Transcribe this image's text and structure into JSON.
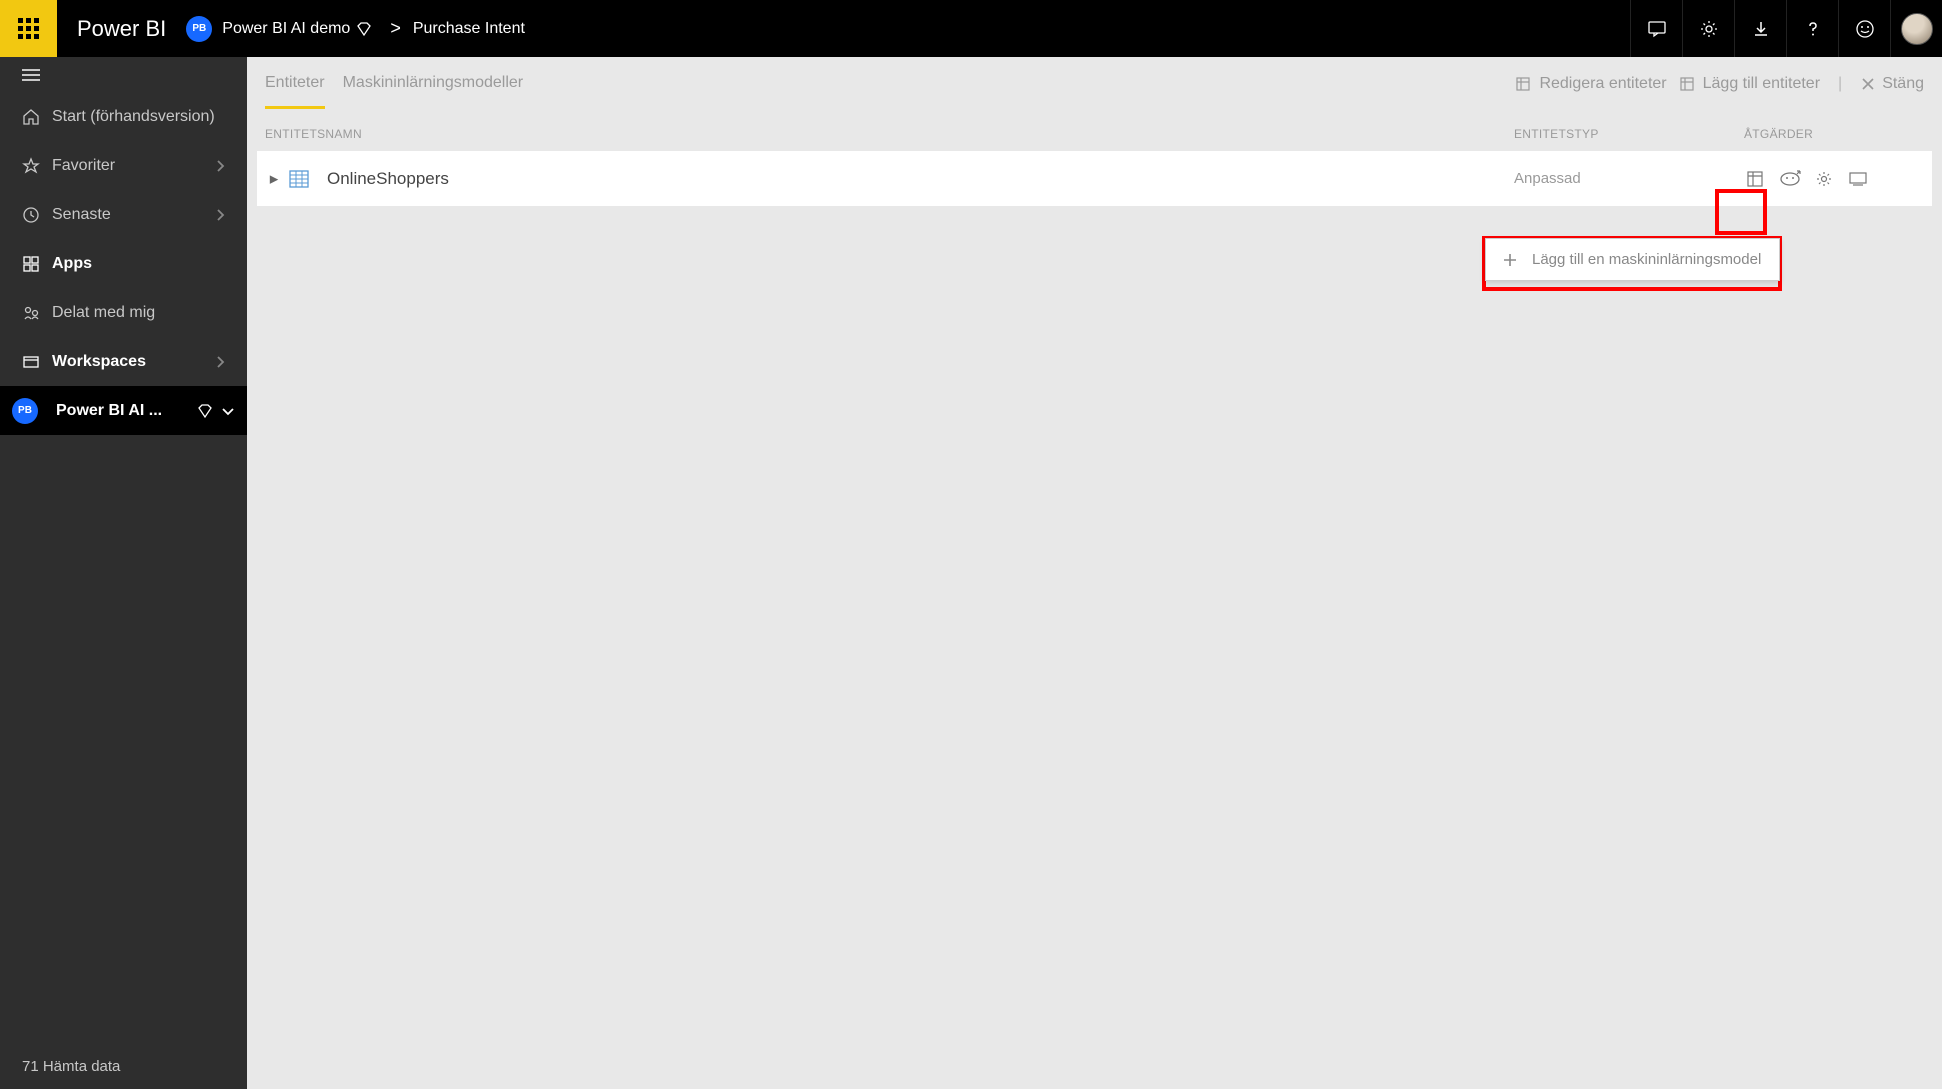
{
  "header": {
    "brand": "Power BI",
    "workspace_chip": "PB",
    "workspace_name": "Power BI AI demo",
    "page_name": "Purchase Intent",
    "separator": ">"
  },
  "sidebar": {
    "items": [
      {
        "label": "Start (förhandsversion)",
        "icon": "home"
      },
      {
        "label": "Favoriter",
        "icon": "star",
        "chev": true
      },
      {
        "label": "Senaste",
        "icon": "clock",
        "chev": true
      },
      {
        "label": "Apps",
        "icon": "apps",
        "bold": true
      },
      {
        "label": "Delat med mig",
        "icon": "share"
      },
      {
        "label": "Workspaces",
        "icon": "workspace",
        "chev": true,
        "bold": true
      }
    ],
    "workspace": {
      "chip": "PB",
      "label": "Power BI AI ..."
    },
    "footer": "71 Hämta data"
  },
  "toolbar": {
    "tabs": [
      {
        "label": "Entiteter",
        "active": true
      },
      {
        "label": "Maskininlärningsmodeller",
        "active": false
      }
    ],
    "edit_entities": "Redigera entiteter",
    "add_entities": "Lägg till entiteter",
    "close": "Stäng"
  },
  "columns": {
    "name": "Entitetsnamn",
    "type": "Entitetstyp",
    "actions": "Åtgärder"
  },
  "entities": [
    {
      "name": "OnlineShoppers",
      "type": "Anpassad"
    }
  ],
  "dropdown": {
    "add_ml_model": "Lägg till en maskininlärningsmodel"
  }
}
